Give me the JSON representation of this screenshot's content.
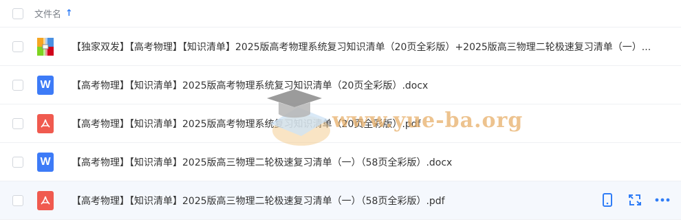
{
  "header": {
    "column_label": "文件名",
    "sort_indicator": "↑"
  },
  "files": [
    {
      "name": "【独家双发】【高考物理】【知识清单】2025版高考物理系统复习知识清单（20页全彩版）+2025版高三物理二轮极速复习清单（一）...",
      "type": "zip",
      "icon": "archive-icon"
    },
    {
      "name": "【高考物理】【知识清单】2025版高考物理系统复习知识清单（20页全彩版）.docx",
      "type": "docx",
      "icon": "word-icon",
      "icon_letter": "W"
    },
    {
      "name": "【高考物理】【知识清单】2025版高考物理系统复习知识清单（20页全彩版）.pdf",
      "type": "pdf",
      "icon": "pdf-icon"
    },
    {
      "name": "【高考物理】【知识清单】2025版高三物理二轮极速复习清单（一）（58页全彩版）.docx",
      "type": "docx",
      "icon": "word-icon",
      "icon_letter": "W"
    },
    {
      "name": "【高考物理】【知识清单】2025版高三物理二轮极速复习清单（一）（58页全彩版）.pdf",
      "type": "pdf",
      "icon": "pdf-icon"
    }
  ],
  "row_actions": [
    {
      "icon": "phone-icon"
    },
    {
      "icon": "convert-icon"
    },
    {
      "icon": "more-icon"
    }
  ],
  "watermark": {
    "text": "www.yue-ba.org"
  },
  "colors": {
    "accent": "#2f7cf6",
    "word": "#3d7bf7",
    "pdf": "#f05a4f",
    "hover_row": "#f5f8fd"
  }
}
